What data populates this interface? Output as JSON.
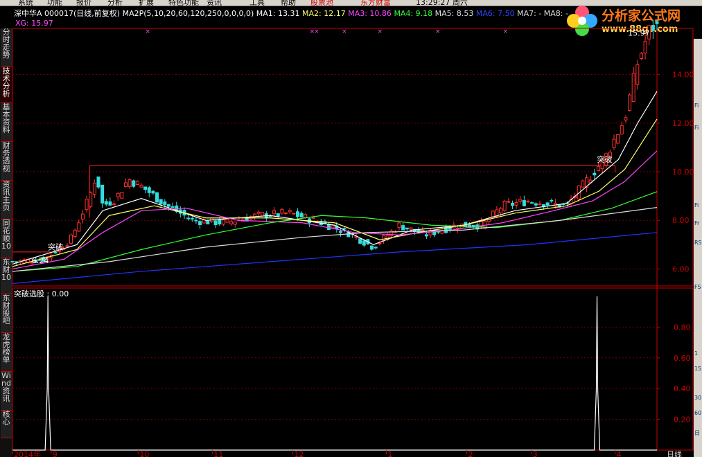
{
  "menu": [
    "系统",
    "功能",
    "报价",
    "分析",
    "扩展",
    "特色功能",
    "资讯",
    "工具",
    "帮助",
    "股票池",
    "东方财富",
    "13:29:27 周六"
  ],
  "left_tabs": [
    "分时走势",
    "技术分析",
    "基本资料",
    "财务透视",
    "资讯主页",
    "同花顺10",
    "东财10",
    "东财股吧",
    "龙虎榜单",
    "Wind资讯",
    "核心"
  ],
  "header": {
    "stock": "深中华A 000017(日线,前复权)",
    "indicator": "MA2P(5,10,20,60,120,250,0,0,0,0)",
    "ma1_label": "MA1: 13.31",
    "ma2_label": "MA2: 12.17",
    "ma3_label": "MA3: 10.86",
    "ma4_label": "MA4: 9.18",
    "ma5_label": "MA5: 8.53",
    "ma6_label": "MA6: 7.50",
    "ma7_label": "MA7: -",
    "ma8_label": "MA8: -",
    "xg_label": "XG: 15.97"
  },
  "colors": {
    "ma1": "#ffffff",
    "ma2": "#ffff66",
    "ma3": "#ff44ff",
    "ma4": "#33ff33",
    "ma5": "#dddddd",
    "ma6": "#2233ff",
    "up": "#ff3030",
    "down": "#33dddd",
    "grid": "#7a0000",
    "axis": "#cc0000",
    "xg_mark": "#ff44ff",
    "signal": "#ffffff"
  },
  "logo": {
    "title": "分析家公式网",
    "url": "www.88gs.com"
  },
  "right_tools": [
    "Fi",
    "Fi",
    "Fi",
    "Fr",
    "RS",
    "FS",
    "1",
    "15",
    "30",
    "60",
    "日"
  ],
  "chart_data": [
    {
      "type": "candlestick",
      "title": "深中华A 000017(日线,前复权)",
      "ylim": [
        5.3,
        15.9
      ],
      "yticks": [
        "14.00",
        "12.00",
        "10.00",
        "8.00",
        "6.00"
      ],
      "yvalues": [
        14,
        12,
        10,
        8,
        6
      ],
      "annotations": [
        {
          "text": "突破",
          "at": 0.055,
          "y": 6.8
        },
        {
          "text": "突破",
          "at": 0.907,
          "y": 10.4
        },
        {
          "text": "6.24",
          "at": 0.03,
          "y": 6.24
        },
        {
          "text": "15.97",
          "at": 0.955,
          "y": 15.6
        }
      ],
      "resistance": 10.25,
      "price_path": [
        [
          0,
          6.3
        ],
        [
          0.05,
          6.4
        ],
        [
          0.09,
          7.2
        ],
        [
          0.12,
          9.0
        ],
        [
          0.13,
          9.9
        ],
        [
          0.14,
          8.6
        ],
        [
          0.16,
          8.9
        ],
        [
          0.18,
          9.7
        ],
        [
          0.2,
          9.4
        ],
        [
          0.24,
          8.6
        ],
        [
          0.28,
          8.0
        ],
        [
          0.33,
          7.9
        ],
        [
          0.38,
          8.2
        ],
        [
          0.43,
          8.3
        ],
        [
          0.48,
          7.9
        ],
        [
          0.52,
          7.5
        ],
        [
          0.56,
          6.9
        ],
        [
          0.6,
          7.8
        ],
        [
          0.64,
          7.4
        ],
        [
          0.69,
          7.8
        ],
        [
          0.73,
          7.8
        ],
        [
          0.76,
          8.6
        ],
        [
          0.8,
          8.8
        ],
        [
          0.86,
          8.6
        ],
        [
          0.89,
          9.6
        ],
        [
          0.92,
          10.6
        ],
        [
          0.95,
          12.2
        ],
        [
          0.97,
          14.5
        ],
        [
          0.99,
          15.97
        ]
      ],
      "ma_paths": {
        "ma1": [
          [
            0,
            6.2
          ],
          [
            0.1,
            7.0
          ],
          [
            0.14,
            8.4
          ],
          [
            0.2,
            8.9
          ],
          [
            0.3,
            8.0
          ],
          [
            0.4,
            8.2
          ],
          [
            0.5,
            7.8
          ],
          [
            0.56,
            7.0
          ],
          [
            0.62,
            7.6
          ],
          [
            0.7,
            7.8
          ],
          [
            0.78,
            8.4
          ],
          [
            0.86,
            8.7
          ],
          [
            0.9,
            9.6
          ],
          [
            0.94,
            10.5
          ],
          [
            0.97,
            12.0
          ],
          [
            1.0,
            13.31
          ]
        ],
        "ma2": [
          [
            0,
            6.1
          ],
          [
            0.1,
            6.8
          ],
          [
            0.15,
            8.2
          ],
          [
            0.22,
            8.6
          ],
          [
            0.3,
            8.1
          ],
          [
            0.4,
            8.1
          ],
          [
            0.5,
            7.9
          ],
          [
            0.57,
            7.2
          ],
          [
            0.63,
            7.5
          ],
          [
            0.7,
            7.8
          ],
          [
            0.78,
            8.3
          ],
          [
            0.86,
            8.6
          ],
          [
            0.91,
            9.2
          ],
          [
            0.95,
            10.1
          ],
          [
            1.0,
            12.17
          ]
        ],
        "ma3": [
          [
            0,
            6.0
          ],
          [
            0.08,
            6.4
          ],
          [
            0.14,
            7.5
          ],
          [
            0.2,
            8.4
          ],
          [
            0.27,
            8.5
          ],
          [
            0.35,
            8.0
          ],
          [
            0.45,
            7.9
          ],
          [
            0.53,
            7.5
          ],
          [
            0.6,
            7.4
          ],
          [
            0.68,
            7.6
          ],
          [
            0.76,
            7.9
          ],
          [
            0.84,
            8.4
          ],
          [
            0.9,
            8.8
          ],
          [
            0.95,
            9.6
          ],
          [
            1.0,
            10.86
          ]
        ],
        "ma4": [
          [
            0,
            5.9
          ],
          [
            0.1,
            6.1
          ],
          [
            0.2,
            6.8
          ],
          [
            0.3,
            7.4
          ],
          [
            0.4,
            7.9
          ],
          [
            0.48,
            8.2
          ],
          [
            0.55,
            8.1
          ],
          [
            0.65,
            7.8
          ],
          [
            0.75,
            7.7
          ],
          [
            0.85,
            8.0
          ],
          [
            0.93,
            8.5
          ],
          [
            1.0,
            9.18
          ]
        ],
        "ma5": [
          [
            0,
            5.9
          ],
          [
            0.15,
            6.3
          ],
          [
            0.3,
            6.9
          ],
          [
            0.45,
            7.3
          ],
          [
            0.55,
            7.5
          ],
          [
            0.7,
            7.6
          ],
          [
            0.85,
            8.0
          ],
          [
            1.0,
            8.53
          ]
        ],
        "ma6": [
          [
            0,
            5.4
          ],
          [
            0.2,
            5.9
          ],
          [
            0.4,
            6.3
          ],
          [
            0.6,
            6.7
          ],
          [
            0.8,
            7.0
          ],
          [
            1.0,
            7.5
          ]
        ]
      },
      "xg_marks": [
        0.21,
        0.465,
        0.472,
        0.515,
        0.57,
        0.66,
        0.765
      ]
    },
    {
      "type": "line",
      "title": "突破选股",
      "value_label": "突破选股 : 0.00",
      "ylim": [
        0,
        1.0
      ],
      "yticks": [
        "0.80",
        "0.60",
        "0.40",
        "0.20"
      ],
      "yvalues": [
        0.8,
        0.6,
        0.4,
        0.2
      ],
      "spikes": [
        0.055,
        0.907
      ]
    }
  ],
  "x_axis_labels": [
    "2014年",
    "9",
    "10",
    "11",
    "12",
    "1",
    "2",
    "3",
    "4",
    "日线"
  ]
}
